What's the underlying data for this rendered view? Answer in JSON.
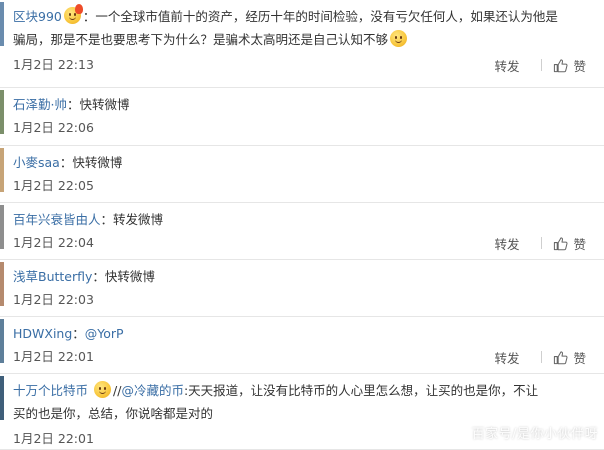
{
  "colors": {
    "link": "#3a6ea5",
    "text": "#333333",
    "meta": "#555555",
    "divider": "#e6e6e6"
  },
  "labels": {
    "forward": "转发",
    "like": "赞"
  },
  "comments": [
    {
      "user": "区块990",
      "emoji": "fire-face-emoji",
      "text_line1": "：一个全球市值前十的资产，经历十年的时间检验，没有亏欠任何人，如果还认为他是",
      "text_line2": "骗局，那是不是也要思考下为什么？是骗术太高明还是自己认知不够",
      "emoji_end": "smile-emoji",
      "time": "1月2日 22:13",
      "show_actions": true,
      "avatar_color": "#6a8cae"
    },
    {
      "user": "石泽勤·帅",
      "text_line1": "：快转微博",
      "time": "1月2日 22:06",
      "show_actions": false,
      "avatar_color": "#7b8f6a"
    },
    {
      "user": "小麥saa",
      "text_line1": "：快转微博",
      "time": "1月2日 22:05",
      "show_actions": false,
      "avatar_color": "#c7a477"
    },
    {
      "user": "百年兴衰皆由人",
      "text_line1": "：转发微博",
      "time": "1月2日 22:04",
      "show_actions": true,
      "avatar_color": "#8e8e8e"
    },
    {
      "user": "浅草Butterfly",
      "text_line1": "：快转微博",
      "time": "1月2日 22:03",
      "show_actions": false,
      "avatar_color": "#b58a6e"
    },
    {
      "user": "HDWXing",
      "text_line1": "：",
      "mention": "@YorP",
      "time": "1月2日 22:01",
      "show_actions": true,
      "avatar_color": "#5e7f9a"
    },
    {
      "user": "十万个比特币",
      "emoji": "drool-face-emoji",
      "text_prefix": "//",
      "mention": "@冷藏的币",
      "text_line1": ":天天报道，让没有比特币的人心里怎么想，让买的也是你，不让",
      "text_line2": "买的也是你，总结，你说啥都是对的",
      "time": "1月2日 22:01",
      "show_actions": false,
      "avatar_color": "#3f5f7a"
    }
  ],
  "watermark": "百家号/是你小伙伴呀"
}
